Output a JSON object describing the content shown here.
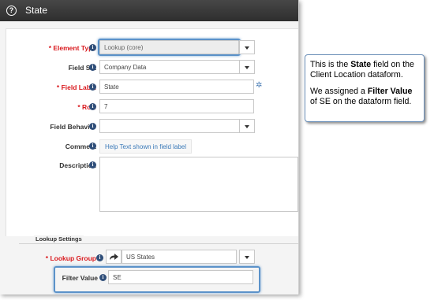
{
  "dialog": {
    "title": "State",
    "help_glyph": "?"
  },
  "form": {
    "element_type": {
      "label": "* Element Type",
      "value": "Lookup (core)"
    },
    "field_set": {
      "label": "Field Set",
      "value": "Company Data"
    },
    "field_label": {
      "label": "* Field Label",
      "value": "State"
    },
    "row": {
      "label": "* Row",
      "value": "7"
    },
    "field_behavior": {
      "label": "Field Behavior",
      "value": ""
    },
    "comment": {
      "label": "Comment",
      "value": "Help Text shown in field label"
    },
    "description": {
      "label": "Description",
      "value": ""
    }
  },
  "lookup_settings": {
    "section_title": "Lookup Settings",
    "lookup_group": {
      "label": "* Lookup Group",
      "value": "US States"
    },
    "filter_value": {
      "label": "Filter Value",
      "value": "SE"
    }
  },
  "callout": {
    "p1_pre": "This is the ",
    "p1_bold": "State",
    "p1_post": " field on the Client Location dataform.",
    "p2_pre": "We assigned a ",
    "p2_bold": "Filter Value",
    "p2_post": " of SE on the dataform field."
  },
  "icons": {
    "info": "info-icon",
    "gear": "gear-icon",
    "share": "share-arrow-icon",
    "help": "help-icon"
  },
  "colors": {
    "required": "#d9191e",
    "highlight": "#5b92c9",
    "titlebar": "#3a3a3a"
  }
}
